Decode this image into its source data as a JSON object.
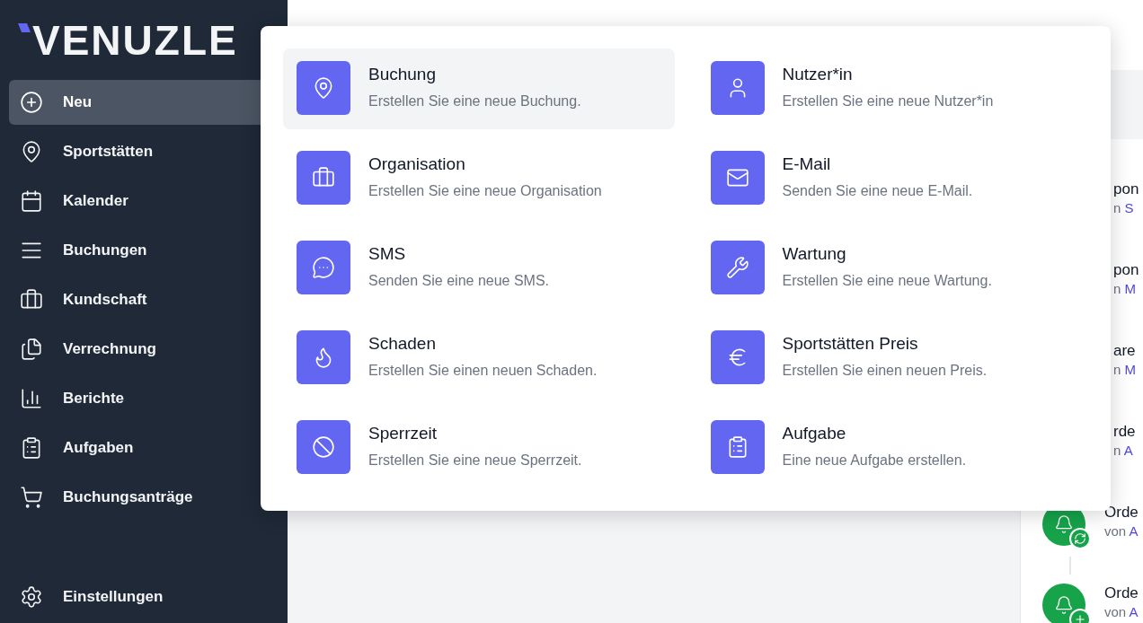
{
  "logo": {
    "text": "VENUZLE"
  },
  "sidebar": {
    "items": [
      {
        "label": "Neu",
        "selected": true
      },
      {
        "label": "Sportstätten",
        "selected": false
      },
      {
        "label": "Kalender",
        "selected": false
      },
      {
        "label": "Buchungen",
        "selected": false
      },
      {
        "label": "Kundschaft",
        "selected": false
      },
      {
        "label": "Verrechnung",
        "selected": false
      },
      {
        "label": "Berichte",
        "selected": false
      },
      {
        "label": "Aufgaben",
        "selected": false
      },
      {
        "label": "Buchungsanträge",
        "selected": false
      }
    ],
    "footer_item": {
      "label": "Einstellungen",
      "selected": false
    }
  },
  "new_menu": {
    "items": [
      {
        "title": "Buchung",
        "description": "Erstellen Sie eine neue Buchung.",
        "selected": true
      },
      {
        "title": "Nutzer*in",
        "description": "Erstellen Sie eine neue Nutzer*in",
        "selected": false
      },
      {
        "title": "Organisation",
        "description": "Erstellen Sie eine neue Organisation",
        "selected": false
      },
      {
        "title": "E-Mail",
        "description": "Senden Sie eine neue E-Mail.",
        "selected": false
      },
      {
        "title": "SMS",
        "description": "Senden Sie eine neue SMS.",
        "selected": false
      },
      {
        "title": "Wartung",
        "description": "Erstellen Sie eine neue Wartung.",
        "selected": false
      },
      {
        "title": "Schaden",
        "description": "Erstellen Sie einen neuen Schaden.",
        "selected": false
      },
      {
        "title": "Sportstätten Preis",
        "description": "Erstellen Sie einen neuen Preis.",
        "selected": false
      },
      {
        "title": "Sperrzeit",
        "description": "Erstellen Sie eine neue Sperrzeit.",
        "selected": false
      },
      {
        "title": "Aufgabe",
        "description": "Eine neue Aufgabe erstellen.",
        "selected": false
      }
    ]
  },
  "activity_feed": {
    "items": [
      {
        "title": "pon",
        "by": "n",
        "author": "S",
        "kind": "partial"
      },
      {
        "title": "pon",
        "by": "n",
        "author": "M",
        "kind": "partial"
      },
      {
        "title": "are",
        "by": "n",
        "author": "M",
        "kind": "partial"
      },
      {
        "title": "rde",
        "by": "n",
        "author": "A",
        "kind": "partial"
      },
      {
        "title": "Orde",
        "by": "von",
        "author": "A",
        "kind": "refresh"
      },
      {
        "title": "Orde",
        "by": "von",
        "author": "A",
        "kind": "plus"
      }
    ]
  }
}
